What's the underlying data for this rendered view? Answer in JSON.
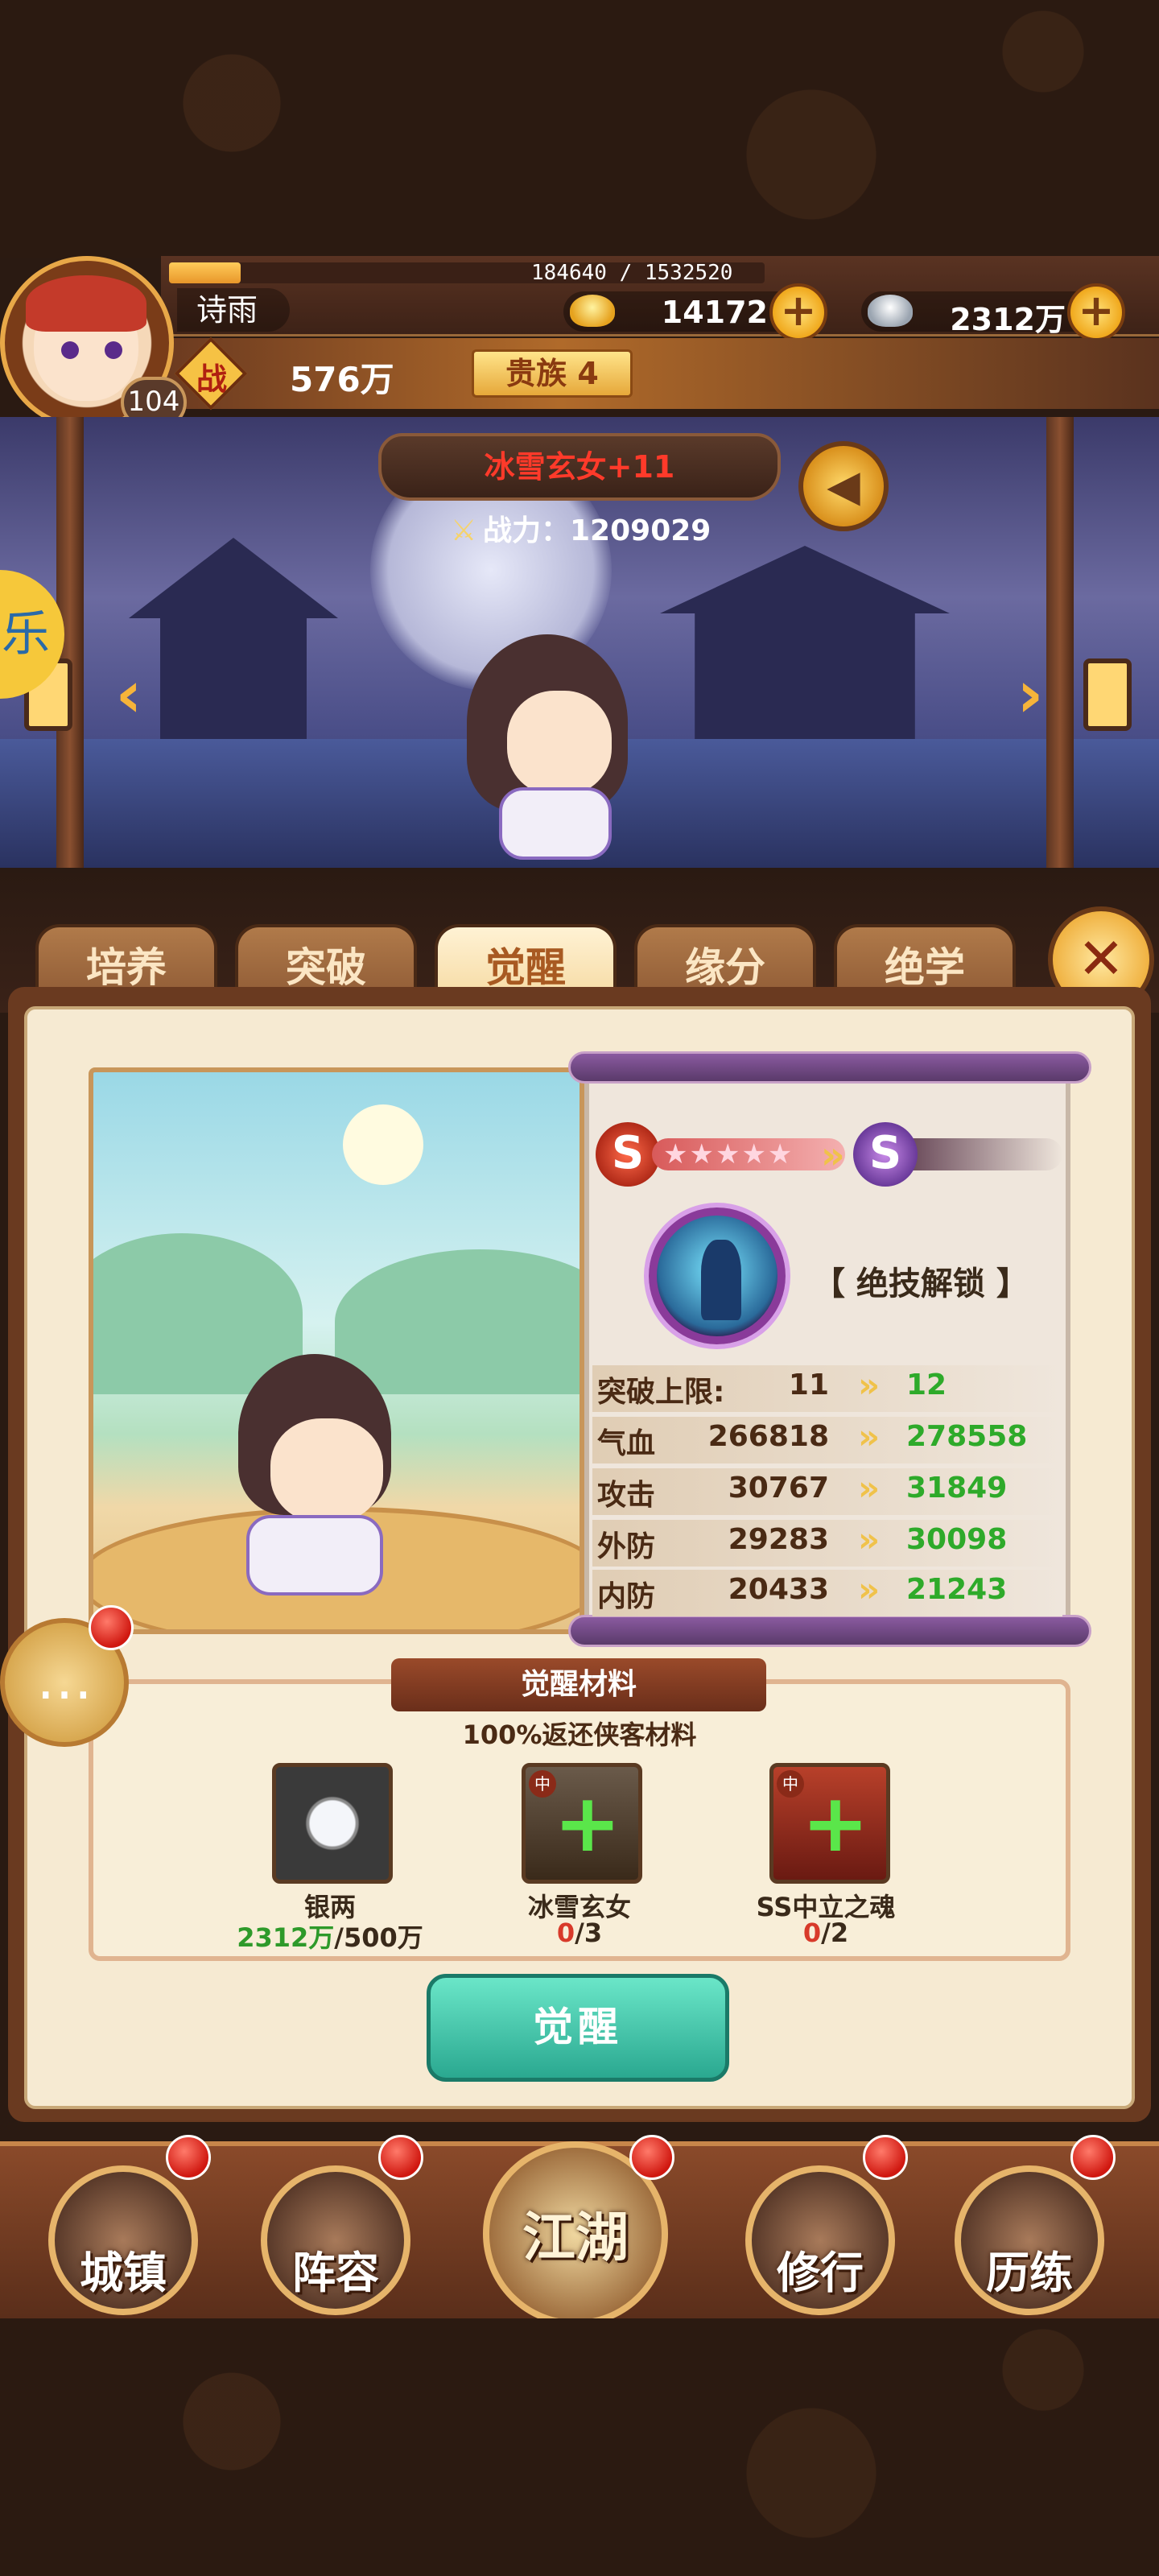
{
  "header": {
    "exp_text": "184640 / 1532520",
    "exp_fraction": 0.12,
    "player_name": "诗雨",
    "level": "104",
    "gold": "14172",
    "silver": "2312万",
    "power_badge": "战",
    "power": "576万",
    "noble": "贵族 4",
    "plus_symbol": "+"
  },
  "hero": {
    "name": "冰雪玄女+11",
    "power_label": "战力：1209029",
    "side_tab_char": "乐"
  },
  "tabs": [
    {
      "label": "培养"
    },
    {
      "label": "突破"
    },
    {
      "label": "觉醒",
      "active": true
    },
    {
      "label": "缘分"
    },
    {
      "label": "绝学"
    }
  ],
  "panel": {
    "grade_from": "S",
    "grade_to": "S",
    "stars": "★★★★★",
    "skill_unlock": "【 绝技解锁 】",
    "stats": [
      {
        "label": "突破上限:",
        "old": "11",
        "new": "12"
      },
      {
        "label": "气血",
        "old": "266818",
        "new": "278558"
      },
      {
        "label": "攻击",
        "old": "30767",
        "new": "31849"
      },
      {
        "label": "外防",
        "old": "29283",
        "new": "30098"
      },
      {
        "label": "内防",
        "old": "20433",
        "new": "21243"
      }
    ]
  },
  "materials": {
    "title": "觉醒材料",
    "subtitle": "100%返还侠客材料",
    "items": [
      {
        "name": "银两",
        "have": "2312万",
        "need": "/500万"
      },
      {
        "name": "冰雪玄女",
        "have": "0",
        "need": "/3",
        "tag": "中"
      },
      {
        "name": "SS中立之魂",
        "have": "0",
        "need": "/2",
        "tag": "中"
      }
    ],
    "awaken_button": "觉醒"
  },
  "nav": [
    {
      "label": "城镇"
    },
    {
      "label": "阵容"
    },
    {
      "label": "江湖"
    },
    {
      "label": "修行"
    },
    {
      "label": "历练"
    }
  ]
}
